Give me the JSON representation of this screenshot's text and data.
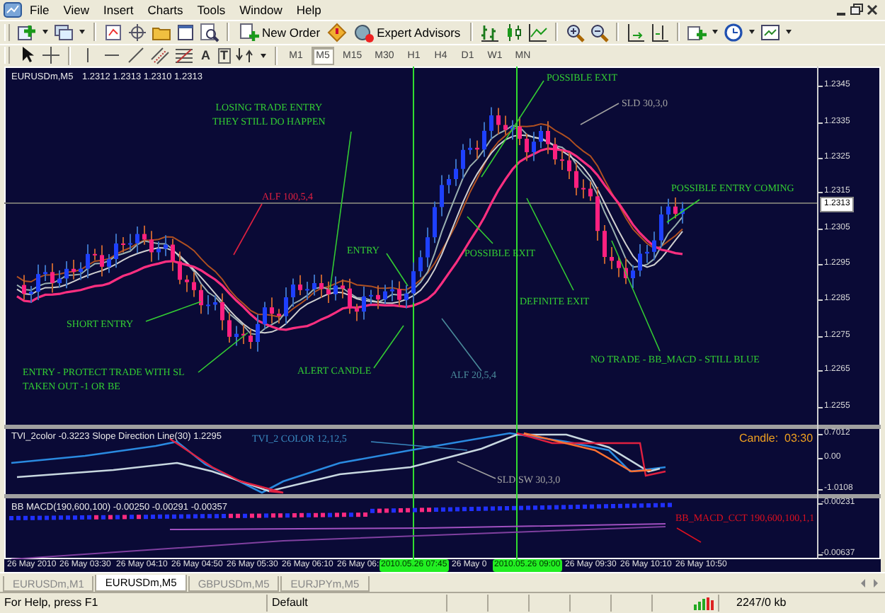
{
  "menu_bar": {
    "items": [
      "File",
      "View",
      "Insert",
      "Charts",
      "Tools",
      "Window",
      "Help"
    ]
  },
  "toolbar": {
    "new_order": "New Order",
    "expert_advisors": "Expert Advisors"
  },
  "drawing_toolbar": {
    "text_tool": "A",
    "label_tool": "T",
    "timeframes": [
      {
        "label": "M1",
        "selected": false
      },
      {
        "label": "M5",
        "selected": true
      },
      {
        "label": "M15",
        "selected": false
      },
      {
        "label": "M30",
        "selected": false
      },
      {
        "label": "H1",
        "selected": false
      },
      {
        "label": "H4",
        "selected": false
      },
      {
        "label": "D1",
        "selected": false
      },
      {
        "label": "W1",
        "selected": false
      },
      {
        "label": "MN",
        "selected": false
      }
    ]
  },
  "chart": {
    "symbol": "EURUSDm,M5",
    "ohlc": "1.2312 1.2313 1.2310 1.2313",
    "price_axis": [
      "1.2345",
      "1.2335",
      "1.2325",
      "1.2315",
      "1.2305",
      "1.2295",
      "1.2285",
      "1.2275",
      "1.2265",
      "1.2255"
    ],
    "current_price": "1.2313",
    "annotations": [
      {
        "text": "LOSING TRADE ENTRY\nTHEY STILL DO HAPPEN",
        "color": "#33cc33"
      },
      {
        "text": "POSSIBLE EXIT",
        "color": "#33cc33"
      },
      {
        "text": "SLD 30,3,0",
        "color": "#a0a0a0"
      },
      {
        "text": "ALF 100,5,4",
        "color": "#dd2040"
      },
      {
        "text": "POSSIBLE ENTRY COMING",
        "color": "#33cc33"
      },
      {
        "text": "ENTRY",
        "color": "#33cc33"
      },
      {
        "text": "POSSIBLE EXIT",
        "color": "#33cc33"
      },
      {
        "text": "DEFINITE EXIT",
        "color": "#33cc33"
      },
      {
        "text": "SHORT ENTRY",
        "color": "#33cc33"
      },
      {
        "text": "ENTRY - PROTECT TRADE WITH SL\nTAKEN OUT -1 OR BE",
        "color": "#33cc33"
      },
      {
        "text": "ALERT CANDLE",
        "color": "#33cc33"
      },
      {
        "text": "NO TRADE - BB_MACD - STILL BLUE",
        "color": "#33cc33"
      },
      {
        "text": "ALF 20,5,4",
        "color": "#4a8a9a"
      },
      {
        "text": "TVI_2 COLOR 12,12,5",
        "color": "#3a8ac0"
      },
      {
        "text": "SLD SW 30,3,0",
        "color": "#a0a0a0"
      },
      {
        "text": "BB_MACD_CCT 190,600,100,1,1",
        "color": "#dd1020"
      }
    ]
  },
  "indicator_panes": [
    {
      "title": "TVI_2color -0.3223  Slope Direction Line(30) 1.2295",
      "axis": [
        "0.7012",
        "0.00",
        "-1.0108"
      ],
      "candle_timer": "Candle:  03:30"
    },
    {
      "title": "BB MACD(190,600,100) -0.00250 -0.00291 -0.00357",
      "axis": [
        "-0.00231",
        "-0.00637"
      ]
    }
  ],
  "time_axis": [
    {
      "label": "26 May 2010",
      "kind": "plain"
    },
    {
      "label": "26 May 03:30",
      "kind": "plain"
    },
    {
      "label": "26 May 04:10",
      "kind": "plain"
    },
    {
      "label": "26 May 04:50",
      "kind": "plain"
    },
    {
      "label": "26 May 05:30",
      "kind": "plain"
    },
    {
      "label": "26 May 06:10",
      "kind": "plain"
    },
    {
      "label": "26 May 06:",
      "kind": "plain"
    },
    {
      "label": "2010.05.26 07:45",
      "kind": "marker"
    },
    {
      "label": "26 May 0",
      "kind": "plain"
    },
    {
      "label": "2010.05.26 09:00",
      "kind": "marker"
    },
    {
      "label": "26 May 09:30",
      "kind": "plain"
    },
    {
      "label": "26 May 10:10",
      "kind": "plain"
    },
    {
      "label": "26 May 10:50",
      "kind": "plain"
    }
  ],
  "tabs": [
    {
      "label": "EURUSDm,M1",
      "selected": false
    },
    {
      "label": "EURUSDm,M5",
      "selected": true
    },
    {
      "label": "GBPUSDm,M5",
      "selected": false
    },
    {
      "label": "EURJPYm,M5",
      "selected": false
    }
  ],
  "status_bar": {
    "help": "For Help, press F1",
    "profile": "Default",
    "traffic": "2247/0 kb"
  }
}
